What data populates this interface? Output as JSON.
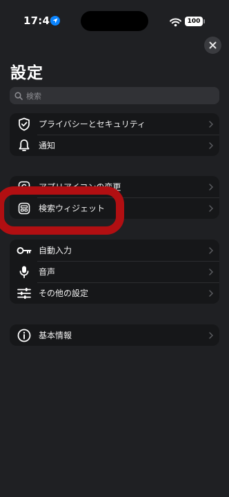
{
  "status_bar": {
    "time": "17:46",
    "battery": "100"
  },
  "page": {
    "title": "設定",
    "close_icon": "close-icon"
  },
  "search": {
    "placeholder": "検索"
  },
  "groups": [
    {
      "items": [
        {
          "label": "プライバシーとセキュリティ",
          "icon": "shield-check-icon"
        },
        {
          "label": "通知",
          "icon": "bell-icon"
        }
      ]
    },
    {
      "items": [
        {
          "label": "アプリアイコンの変更",
          "icon": "app-icon"
        },
        {
          "label": "検索ウィジェット",
          "icon": "widget-icon"
        }
      ]
    },
    {
      "items": [
        {
          "label": "自動入力",
          "icon": "key-icon"
        },
        {
          "label": "音声",
          "icon": "microphone-icon"
        },
        {
          "label": "その他の設定",
          "icon": "sliders-icon"
        }
      ]
    },
    {
      "items": [
        {
          "label": "基本情報",
          "icon": "info-icon"
        }
      ]
    }
  ],
  "colors": {
    "background": "#1f2023",
    "row_background": "#161719",
    "highlight": "#b10f12",
    "location_blue": "#0a84ff"
  }
}
